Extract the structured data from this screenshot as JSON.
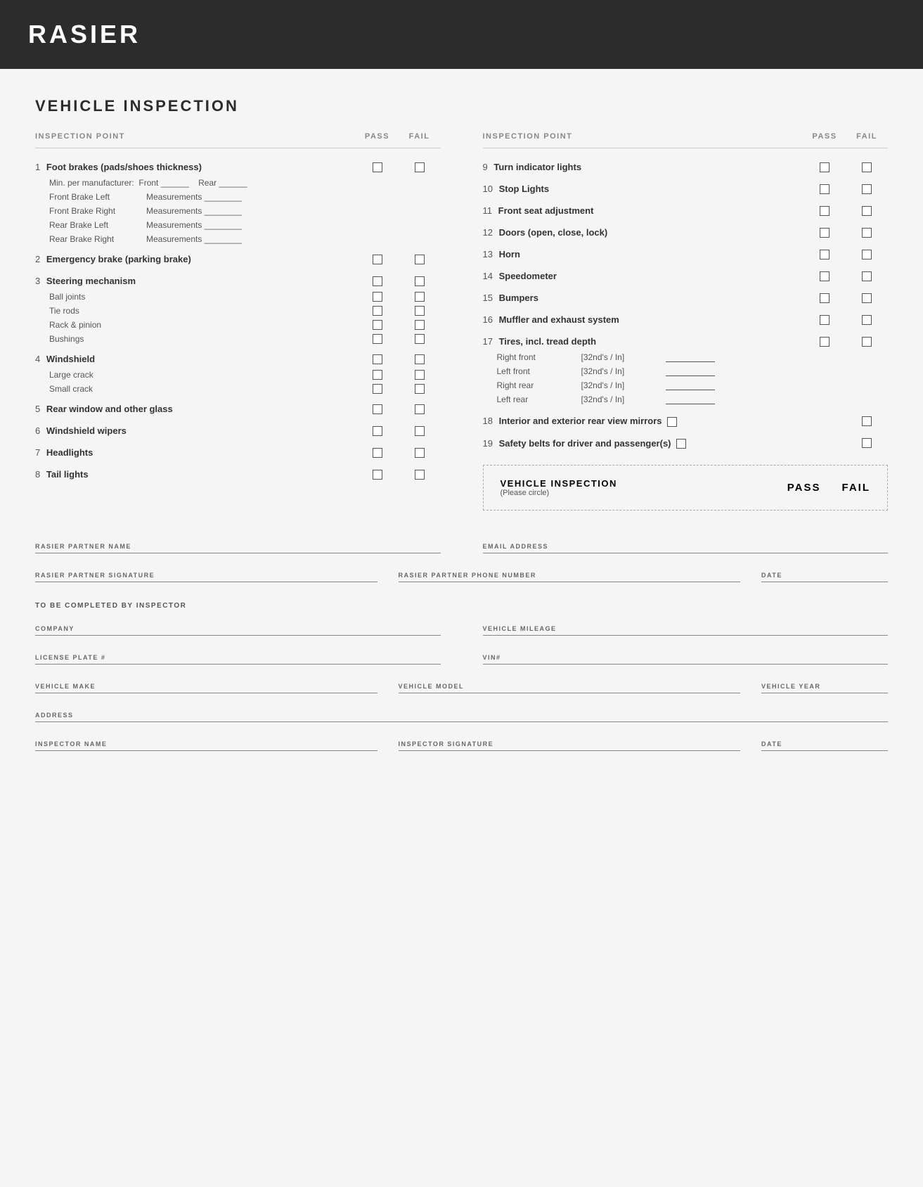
{
  "header": {
    "title": "RASIER"
  },
  "page": {
    "section_title": "VEHICLE INSPECTION",
    "col_header_left": {
      "label": "INSPECTION POINT",
      "pass": "PASS",
      "fail": "FAIL"
    },
    "col_header_right": {
      "label": "INSPECTION POINT",
      "pass": "PASS",
      "fail": "FAIL"
    },
    "left_items": [
      {
        "number": "1",
        "label": "Foot brakes (pads/shoes thickness)",
        "bold": true,
        "has_checkbox": true,
        "sub_items": [
          {
            "type": "min_per",
            "text": "Min. per manufacturer:  Front ______    Rear ______"
          },
          {
            "type": "meas",
            "label": "Front Brake Left",
            "value": "Measurements ________"
          },
          {
            "type": "meas",
            "label": "Front Brake Right",
            "value": "Measurements ________"
          },
          {
            "type": "meas",
            "label": "Rear Brake Left",
            "value": "Measurements ________"
          },
          {
            "type": "meas",
            "label": "Rear Brake Right",
            "value": "Measurements ________"
          }
        ]
      },
      {
        "number": "2",
        "label": "Emergency brake (parking brake)",
        "bold": true,
        "has_checkbox": true
      },
      {
        "number": "3",
        "label": "Steering mechanism",
        "bold": true,
        "has_checkbox": true,
        "sub_items": [
          {
            "type": "checkbox",
            "label": "Ball joints"
          },
          {
            "type": "checkbox",
            "label": "Tie rods"
          },
          {
            "type": "checkbox",
            "label": "Rack & pinion"
          },
          {
            "type": "checkbox",
            "label": "Bushings"
          }
        ]
      },
      {
        "number": "4",
        "label": "Windshield",
        "bold": true,
        "has_checkbox": true,
        "sub_items": [
          {
            "type": "checkbox",
            "label": "Large crack"
          },
          {
            "type": "checkbox",
            "label": "Small crack"
          }
        ]
      },
      {
        "number": "5",
        "label": "Rear window and other glass",
        "bold": true,
        "has_checkbox": true
      },
      {
        "number": "6",
        "label": "Windshield wipers",
        "bold": true,
        "has_checkbox": true
      },
      {
        "number": "7",
        "label": "Headlights",
        "bold": true,
        "has_checkbox": true
      },
      {
        "number": "8",
        "label": "Tail lights",
        "bold": true,
        "has_checkbox": true
      }
    ],
    "right_items": [
      {
        "number": "9",
        "label": "Turn indicator lights",
        "bold": true,
        "has_checkbox": true
      },
      {
        "number": "10",
        "label": "Stop Lights",
        "bold": true,
        "has_checkbox": true
      },
      {
        "number": "11",
        "label": "Front seat adjustment",
        "bold": true,
        "has_checkbox": true
      },
      {
        "number": "12",
        "label": "Doors (open, close, lock)",
        "bold": true,
        "has_checkbox": true
      },
      {
        "number": "13",
        "label": "Horn",
        "bold": true,
        "has_checkbox": true
      },
      {
        "number": "14",
        "label": "Speedometer",
        "bold": true,
        "has_checkbox": true
      },
      {
        "number": "15",
        "label": "Bumpers",
        "bold": true,
        "has_checkbox": true
      },
      {
        "number": "16",
        "label": "Muffler and exhaust system",
        "bold": true,
        "has_checkbox": true
      },
      {
        "number": "17",
        "label": "Tires, incl. tread depth",
        "bold": true,
        "has_checkbox": true,
        "sub_items": [
          {
            "type": "tire",
            "label": "Right front",
            "unit": "[32nd's / In]"
          },
          {
            "type": "tire",
            "label": "Left front",
            "unit": "[32nd's / In]"
          },
          {
            "type": "tire",
            "label": "Right rear",
            "unit": "[32nd's / In]"
          },
          {
            "type": "tire",
            "label": "Left rear",
            "unit": "[32nd's / In]"
          }
        ]
      },
      {
        "number": "18",
        "label": "Interior and exterior rear view mirrors",
        "bold": true,
        "has_checkbox": true
      },
      {
        "number": "19",
        "label": "Safety belts for driver and passenger(s)",
        "bold": true,
        "has_checkbox": true
      }
    ],
    "dashed_box": {
      "title": "VEHICLE INSPECTION",
      "subtitle": "(Please circle)",
      "pass_label": "PASS",
      "fail_label": "FAIL"
    },
    "form_fields": {
      "partner_name_label": "RASIER PARTNER NAME",
      "email_label": "EMAIL ADDRESS",
      "partner_signature_label": "RASIER PARTNER SIGNATURE",
      "phone_label": "RASIER PARTNER PHONE NUMBER",
      "date_label": "DATE",
      "to_be_completed": "TO BE COMPLETED BY INSPECTOR",
      "company_label": "COMPANY",
      "mileage_label": "VEHICLE MILEAGE",
      "license_label": "LICENSE PLATE #",
      "vin_label": "VIN#",
      "make_label": "VEHICLE MAKE",
      "model_label": "VEHICLE MODEL",
      "year_label": "VEHICLE YEAR",
      "address_label": "ADDRESS",
      "inspector_name_label": "INSPECTOR NAME",
      "inspector_sig_label": "INSPECTOR SIGNATURE",
      "inspector_date_label": "DATE"
    }
  }
}
